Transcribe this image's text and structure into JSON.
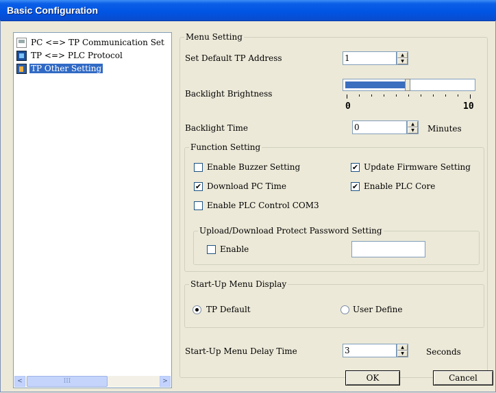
{
  "window": {
    "title": "Basic Configuration"
  },
  "tree": {
    "items": [
      {
        "label": "PC <=> TP Communication Set",
        "icon": "pc-icon"
      },
      {
        "label": "TP <=> PLC Protocol",
        "icon": "protocol-icon"
      },
      {
        "label": "TP Other Setting",
        "icon": "other-setting-icon",
        "selected": true
      }
    ],
    "scroll": {
      "left": "<",
      "right": ">",
      "thumb": "III"
    }
  },
  "menu_setting": {
    "title": "Menu Setting",
    "tp_address_label": "Set Default TP Address",
    "tp_address_value": "1",
    "brightness_label": "Backlight Brightness",
    "brightness_value": 0.5,
    "brightness_min": "0",
    "brightness_max": "10",
    "backlight_time_label": "Backlight Time",
    "backlight_time_value": "0",
    "backlight_time_unit": "Minutes"
  },
  "function_setting": {
    "title": "Function Setting",
    "options": [
      {
        "label": "Enable Buzzer Setting",
        "checked": false
      },
      {
        "label": "Update Firmware Setting",
        "checked": true
      },
      {
        "label": "Download PC Time",
        "checked": true
      },
      {
        "label": "Enable PLC Core",
        "checked": true
      },
      {
        "label": "Enable PLC Control COM3",
        "checked": false
      }
    ],
    "password": {
      "title": "Upload/Download Protect Password Setting",
      "enable_label": "Enable",
      "enabled": false,
      "value": ""
    }
  },
  "startup_menu": {
    "title": "Start-Up Menu Display",
    "options": [
      {
        "label": "TP Default",
        "selected": true
      },
      {
        "label": "User Define",
        "selected": false
      }
    ]
  },
  "startup_delay": {
    "label": "Start-Up Menu Delay Time",
    "value": "3",
    "unit": "Seconds"
  },
  "buttons": {
    "ok": "OK",
    "cancel": "Cancel"
  },
  "marks": {
    "checked": "✔",
    "unchecked": ""
  }
}
